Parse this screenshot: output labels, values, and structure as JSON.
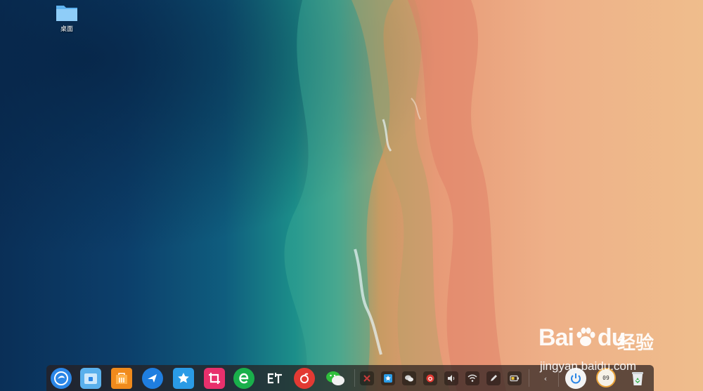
{
  "desktop": {
    "icons": [
      {
        "label": "桌面",
        "icon": "folder-icon"
      }
    ]
  },
  "dock": {
    "apps": [
      {
        "name": "launcher",
        "icon": "deepin-launcher-icon",
        "color": "#2b86e6"
      },
      {
        "name": "file-manager",
        "icon": "file-manager-icon",
        "color": "#3aa0e8"
      },
      {
        "name": "app-store",
        "icon": "app-store-icon",
        "color": "#f08a1c"
      },
      {
        "name": "browser",
        "icon": "bird-browser-icon",
        "color": "#1f7ee0"
      },
      {
        "name": "favorites",
        "icon": "star-chat-icon",
        "color": "#2a9be6"
      },
      {
        "name": "screenshot",
        "icon": "crop-tool-icon",
        "color": "#e8306c"
      },
      {
        "name": "e-app",
        "icon": "green-e-icon",
        "color": "#19b04b"
      },
      {
        "name": "et-app",
        "icon": "et-icon",
        "color": "#3a3a3a"
      },
      {
        "name": "music",
        "icon": "netease-music-icon",
        "color": "#e23a33"
      },
      {
        "name": "wechat",
        "icon": "wechat-icon",
        "color": "#2fbf3c"
      }
    ],
    "tray": {
      "items": [
        {
          "name": "tray-app-1",
          "icon": "red-tray-icon",
          "color": "#c53a3a"
        },
        {
          "name": "tray-star",
          "icon": "blue-star-icon",
          "color": "#2a9be6"
        },
        {
          "name": "tray-wechat",
          "icon": "wechat-small-icon",
          "color": "#cfcfcf"
        },
        {
          "name": "tray-weibo",
          "icon": "weibo-icon",
          "color": "#e23a33"
        },
        {
          "name": "tray-volume",
          "icon": "volume-icon",
          "color": "#e0e0e0"
        },
        {
          "name": "tray-wifi",
          "icon": "wifi-icon",
          "color": "#e0e0e0"
        },
        {
          "name": "tray-pen",
          "icon": "pen-icon",
          "color": "#e0e0e0"
        },
        {
          "name": "tray-battery",
          "icon": "battery-icon",
          "color": "#e0e0e0"
        }
      ],
      "collapse_label": "‹"
    },
    "system": {
      "power_icon": "power-icon",
      "power_color": "#2b86e6",
      "clock_text": "09",
      "trash_icon": "trash-icon"
    }
  },
  "watermark": {
    "brand": "Bai",
    "brand_logo": "paw-logo",
    "brand_suffix": "du",
    "brand_cn": "经验",
    "url": "jingyan.baidu.com"
  }
}
